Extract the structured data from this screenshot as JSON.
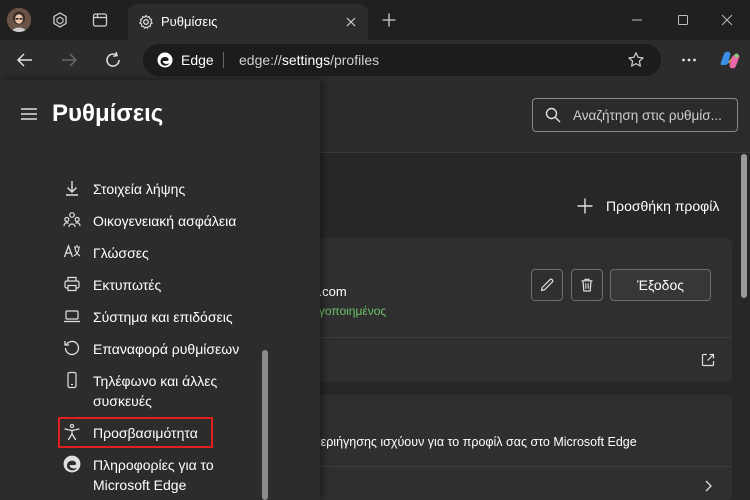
{
  "titlebar": {
    "tab": {
      "title": "Ρυθμίσεις"
    }
  },
  "addressbar": {
    "site_label": "Edge",
    "url_prefix": "edge://",
    "url_main": "settings",
    "url_suffix": "/profiles"
  },
  "header": {
    "search_placeholder": "Αναζήτηση στις ρυθμίσ..."
  },
  "profiles": {
    "add_profile_label": "Προσθήκη προφίλ",
    "email_partial": "k.com",
    "sync_status_partial": "ργοποιημένος",
    "sign_out_label": "Έξοδος",
    "browsing_text_partial": "περιήγησης ισχύουν για το προφίλ σας στο Microsoft Edge"
  },
  "drawer": {
    "title": "Ρυθμίσεις",
    "items": [
      {
        "label": "Στοιχεία λήψης",
        "icon": "download-icon"
      },
      {
        "label": "Οικογενειακή ασφάλεια",
        "icon": "family-icon"
      },
      {
        "label": "Γλώσσες",
        "icon": "languages-icon"
      },
      {
        "label": "Εκτυπωτές",
        "icon": "printer-icon"
      },
      {
        "label": "Σύστημα και επιδόσεις",
        "icon": "laptop-icon"
      },
      {
        "label": "Επαναφορά ρυθμίσεων",
        "icon": "reset-icon"
      },
      {
        "label_line1": "Τηλέφωνο και άλλες",
        "label_line2": "συσκευές",
        "icon": "phone-icon"
      },
      {
        "label": "Προσβασιμότητα",
        "icon": "accessibility-icon"
      },
      {
        "label_line1": "Πληροφορίες για το",
        "label_line2": "Microsoft Edge",
        "icon": "edge-logo-icon"
      }
    ]
  },
  "colors": {
    "background": "#202020",
    "toolbar": "#2c2c2c",
    "sync_green": "#6cc46c",
    "highlight_red": "#e0201f"
  }
}
